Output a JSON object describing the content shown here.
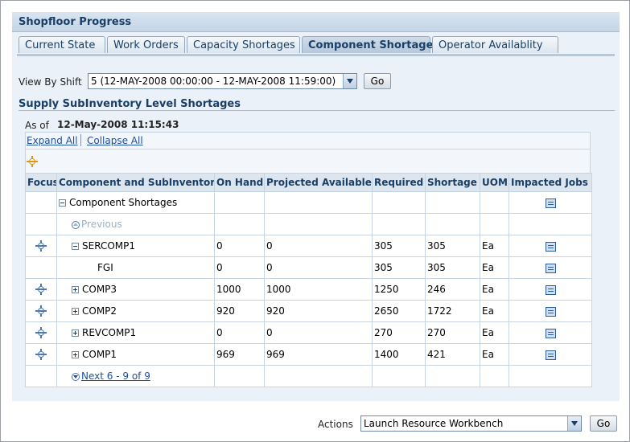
{
  "title": "Shopfloor Progress",
  "tabs": [
    {
      "label": "Current State",
      "active": false
    },
    {
      "label": "Work Orders",
      "active": false
    },
    {
      "label": "Capacity Shortages",
      "active": false
    },
    {
      "label": "Component Shortages",
      "active": true
    },
    {
      "label": "Operator Availablity",
      "active": false
    }
  ],
  "shift": {
    "label": "View By Shift",
    "value": "5 (12-MAY-2008 00:00:00 - 12-MAY-2008 11:59:00)",
    "go_label": "Go"
  },
  "section_title": "Supply SubInventory Level Shortages",
  "as_of": {
    "label": "As of",
    "value": "12-May-2008 11:15:43"
  },
  "expand_all": "Expand All",
  "collapse_all": "Collapse All",
  "columns": [
    "Focus",
    "Component and SubInventory",
    "On Hand",
    "Projected Available",
    "Required",
    "Shortage",
    "UOM",
    "Impacted Jobs"
  ],
  "root_label": "Component Shortages",
  "previous_label": "Previous",
  "rows": [
    {
      "name": "SERCOMP1",
      "on_hand": "0",
      "projected": "0",
      "required": "305",
      "shortage": "305",
      "uom": "Ea"
    },
    {
      "name": "FGI",
      "on_hand": "0",
      "projected": "0",
      "required": "305",
      "shortage": "305",
      "uom": "Ea"
    },
    {
      "name": "COMP3",
      "on_hand": "1000",
      "projected": "1000",
      "required": "1250",
      "shortage": "246",
      "uom": "Ea"
    },
    {
      "name": "COMP2",
      "on_hand": "920",
      "projected": "920",
      "required": "2650",
      "shortage": "1722",
      "uom": "Ea"
    },
    {
      "name": "REVCOMP1",
      "on_hand": "0",
      "projected": "0",
      "required": "270",
      "shortage": "270",
      "uom": "Ea"
    },
    {
      "name": "COMP1",
      "on_hand": "969",
      "projected": "969",
      "required": "1400",
      "shortage": "421",
      "uom": "Ea"
    }
  ],
  "next_label": "Next 6 - 9 of 9",
  "actions": {
    "label": "Actions",
    "value": "Launch Resource Workbench",
    "go_label": "Go"
  }
}
